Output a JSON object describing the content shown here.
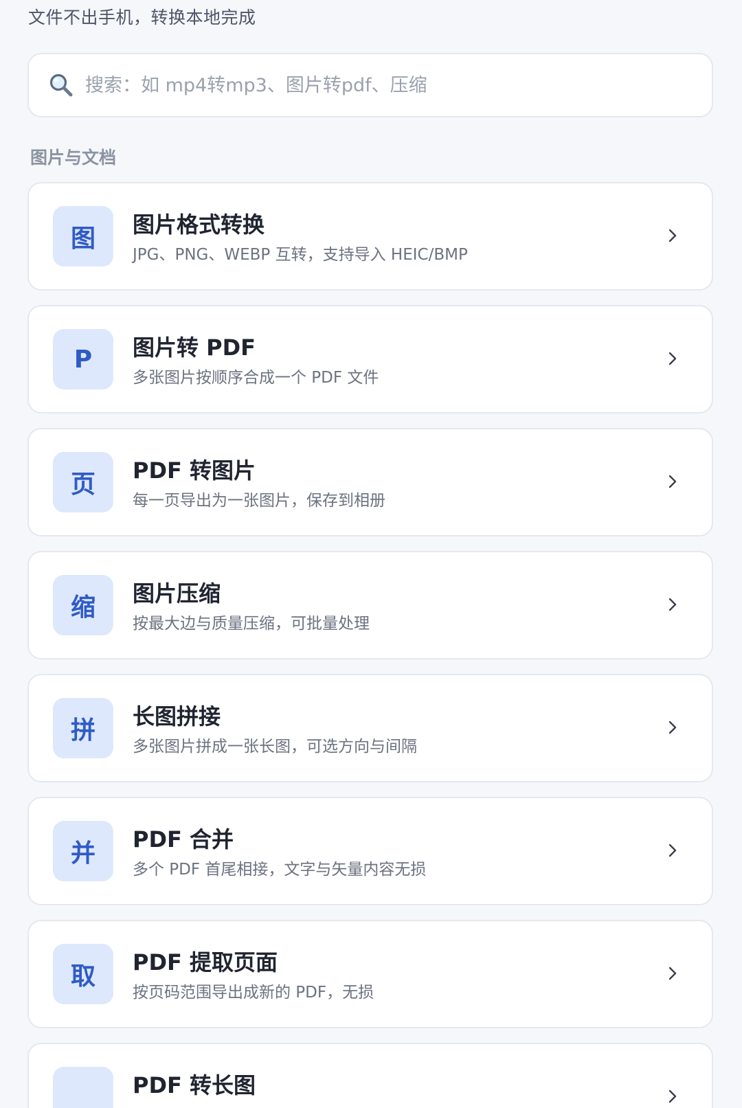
{
  "header": {
    "subtitle": "文件不出手机，转换本地完成"
  },
  "search": {
    "placeholder": "搜索：如 mp4转mp3、图片转pdf、压缩",
    "value": ""
  },
  "section": {
    "title": "图片与文档"
  },
  "colors": {
    "background": "#f5f7fb",
    "card": "#ffffff",
    "icon_bg": "#dde8fd",
    "icon_fg": "#2f5bc4"
  },
  "tools": [
    {
      "glyph": "图",
      "title": "图片格式转换",
      "desc": "JPG、PNG、WEBP 互转，支持导入 HEIC/BMP"
    },
    {
      "glyph": "P",
      "title": "图片转 PDF",
      "desc": "多张图片按顺序合成一个 PDF 文件"
    },
    {
      "glyph": "页",
      "title": "PDF 转图片",
      "desc": "每一页导出为一张图片，保存到相册"
    },
    {
      "glyph": "缩",
      "title": "图片压缩",
      "desc": "按最大边与质量压缩，可批量处理"
    },
    {
      "glyph": "拼",
      "title": "长图拼接",
      "desc": "多张图片拼成一张长图，可选方向与间隔"
    },
    {
      "glyph": "并",
      "title": "PDF 合并",
      "desc": "多个 PDF 首尾相接，文字与矢量内容无损"
    },
    {
      "glyph": "取",
      "title": "PDF 提取页面",
      "desc": "按页码范围导出成新的 PDF，无损"
    },
    {
      "glyph": "",
      "title": "PDF 转长图",
      "desc": ""
    }
  ]
}
